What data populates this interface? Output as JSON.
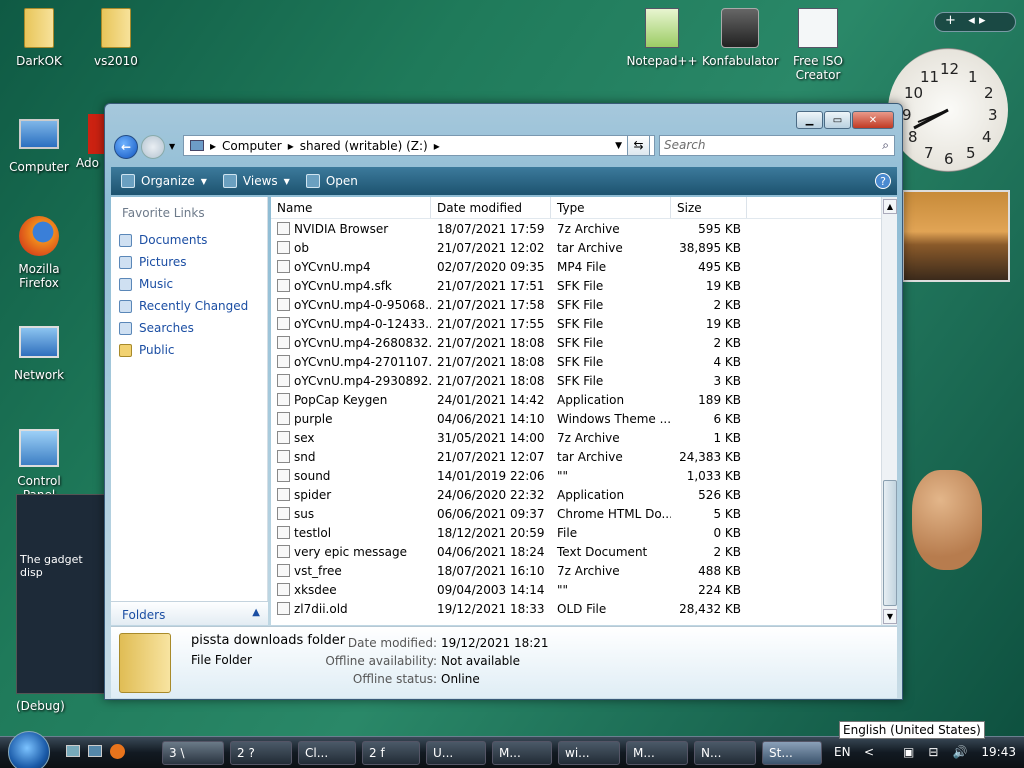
{
  "desktop": {
    "icons": [
      {
        "label": "DarkOK"
      },
      {
        "label": "vs2010"
      },
      {
        "label": "Computer"
      },
      {
        "label": "Ado"
      },
      {
        "label": "Mozilla Firefox"
      },
      {
        "label": "Network"
      },
      {
        "label": "Control Panel"
      },
      {
        "label": "Notepad++"
      },
      {
        "label": "Konfabulator"
      },
      {
        "label": "Free ISO Creator"
      }
    ],
    "gadget_text": "The gadget disp",
    "gadget_sub": "(Debug)"
  },
  "clock": {
    "numbers": [
      "12",
      "1",
      "2",
      "3",
      "4",
      "5",
      "6",
      "7",
      "8",
      "9",
      "10",
      "11"
    ]
  },
  "explorer": {
    "breadcrumb": [
      "Computer",
      "shared (writable) (Z:)"
    ],
    "search_placeholder": "Search",
    "toolbar": {
      "organize": "Organize",
      "views": "Views",
      "open": "Open"
    },
    "favorite_links_header": "Favorite Links",
    "favorite_links": [
      "Documents",
      "Pictures",
      "Music",
      "Recently Changed",
      "Searches",
      "Public"
    ],
    "folders_label": "Folders",
    "columns": [
      "Name",
      "Date modified",
      "Type",
      "Size"
    ],
    "files": [
      {
        "name": "NVIDIA Browser",
        "date": "18/07/2021 17:59",
        "type": "7z Archive",
        "size": "595 KB"
      },
      {
        "name": "ob",
        "date": "21/07/2021 12:02",
        "type": "tar Archive",
        "size": "38,895 KB"
      },
      {
        "name": "oYCvnU.mp4",
        "date": "02/07/2020 09:35",
        "type": "MP4 File",
        "size": "495 KB"
      },
      {
        "name": "oYCvnU.mp4.sfk",
        "date": "21/07/2021 17:51",
        "type": "SFK File",
        "size": "19 KB"
      },
      {
        "name": "oYCvnU.mp4-0-95068...",
        "date": "21/07/2021 17:58",
        "type": "SFK File",
        "size": "2 KB"
      },
      {
        "name": "oYCvnU.mp4-0-12433...",
        "date": "21/07/2021 17:55",
        "type": "SFK File",
        "size": "19 KB"
      },
      {
        "name": "oYCvnU.mp4-2680832...",
        "date": "21/07/2021 18:08",
        "type": "SFK File",
        "size": "2 KB"
      },
      {
        "name": "oYCvnU.mp4-2701107...",
        "date": "21/07/2021 18:08",
        "type": "SFK File",
        "size": "4 KB"
      },
      {
        "name": "oYCvnU.mp4-2930892...",
        "date": "21/07/2021 18:08",
        "type": "SFK File",
        "size": "3 KB"
      },
      {
        "name": "PopCap Keygen",
        "date": "24/01/2021 14:42",
        "type": "Application",
        "size": "189 KB"
      },
      {
        "name": "purple",
        "date": "04/06/2021 14:10",
        "type": "Windows Theme ...",
        "size": "6 KB"
      },
      {
        "name": "sex",
        "date": "31/05/2021 14:00",
        "type": "7z Archive",
        "size": "1 KB"
      },
      {
        "name": "snd",
        "date": "21/07/2021 12:07",
        "type": "tar Archive",
        "size": "24,383 KB"
      },
      {
        "name": "sound",
        "date": "14/01/2019 22:06",
        "type": "\"\"",
        "size": "1,033 KB"
      },
      {
        "name": "spider",
        "date": "24/06/2020 22:32",
        "type": "Application",
        "size": "526 KB"
      },
      {
        "name": "sus",
        "date": "06/06/2021 09:37",
        "type": "Chrome HTML Do...",
        "size": "5 KB"
      },
      {
        "name": "testlol",
        "date": "18/12/2021 20:59",
        "type": "File",
        "size": "0 KB"
      },
      {
        "name": "very epic message",
        "date": "04/06/2021 18:24",
        "type": "Text Document",
        "size": "2 KB"
      },
      {
        "name": "vst_free",
        "date": "18/07/2021 16:10",
        "type": "7z Archive",
        "size": "488 KB"
      },
      {
        "name": "xksdee",
        "date": "09/04/2003 14:14",
        "type": "\"\"",
        "size": "224 KB"
      },
      {
        "name": "zl7dii.old",
        "date": "19/12/2021 18:33",
        "type": "OLD File",
        "size": "28,432 KB"
      }
    ],
    "details": {
      "name": "pissta downloads folder",
      "type": "File Folder",
      "date_label": "Date modified:",
      "date_value": "19/12/2021 18:21",
      "offline_avail_label": "Offline availability:",
      "offline_avail_value": "Not available",
      "offline_status_label": "Offline status:",
      "offline_status_value": "Online"
    }
  },
  "taskbar": {
    "buttons": [
      "3 \\",
      "2 ?",
      "Cl...",
      "2 f",
      "U...",
      "M...",
      "wi...",
      "M...",
      "N...",
      "St..."
    ],
    "lang": "EN",
    "time": "19:43",
    "tooltip": "English (United States)"
  }
}
